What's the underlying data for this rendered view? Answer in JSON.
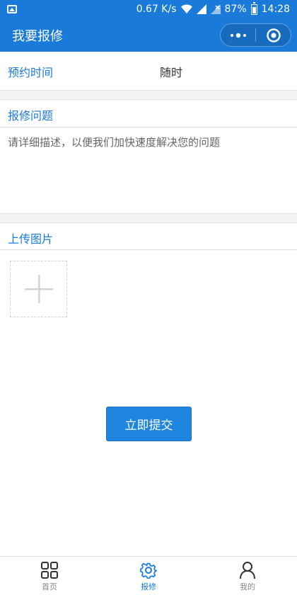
{
  "status_bar": {
    "network_speed": "0.67 K/s",
    "battery_percent": "87%",
    "time": "14:28"
  },
  "nav": {
    "title": "我要报修"
  },
  "form": {
    "time_label": "预约时间",
    "time_value": "随时",
    "issue_label": "报修问题",
    "issue_placeholder": "请详细描述，以便我们加快速度解决您的问题",
    "issue_value": "",
    "upload_label": "上传图片",
    "submit_label": "立即提交"
  },
  "tabbar": {
    "items": [
      {
        "label": "首页",
        "icon": "grid-icon",
        "active": false
      },
      {
        "label": "报修",
        "icon": "gear-icon",
        "active": true
      },
      {
        "label": "我的",
        "icon": "user-icon",
        "active": false
      }
    ]
  },
  "colors": {
    "primary": "#1a7ad9",
    "button": "#1f86df",
    "divider": "#f4f4f4"
  }
}
